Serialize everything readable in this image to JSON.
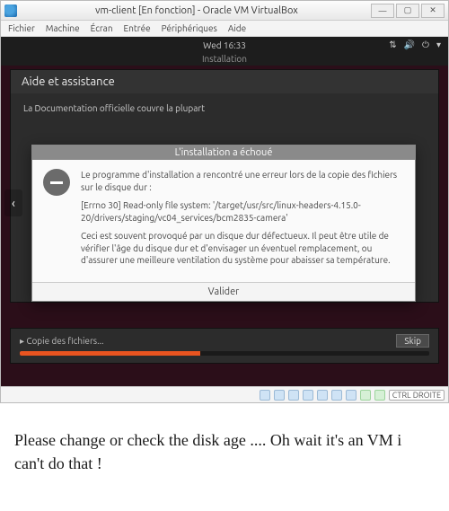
{
  "vb": {
    "title": "vm-client [En fonction] - Oracle VM VirtualBox",
    "menu": [
      "Fichier",
      "Machine",
      "Écran",
      "Entrée",
      "Périphériques",
      "Aide"
    ],
    "win_btns": {
      "min": "—",
      "max": "▢",
      "close": "✕"
    },
    "hostkey": "CTRL DROITE"
  },
  "gnome": {
    "clock": "Wed 16:33",
    "installing": "Installation",
    "net_icon": "⇅",
    "vol_icon": "🔊",
    "bat_icon": "⏻",
    "menu_icon": "▾"
  },
  "installer": {
    "title": "Aide et assistance",
    "intro": "La Documentation officielle couvre la plupart",
    "back": "‹"
  },
  "error": {
    "title": "L'installation a échoué",
    "p1": "Le programme d'installation a rencontré une erreur lors de la copie des fichiers sur le disque dur :",
    "p2": "[Errno 30] Read-only file system: '/target/usr/src/linux-headers-4.15.0-20/drivers/staging/vc04_services/bcm2835-camera'",
    "p3": "Ceci est souvent provoqué par un disque dur défectueux. Il peut être utile de vérifier l'âge du disque dur et d'envisager un éventuel remplacement, ou d'assurer une meilleure ventilation du système pour abaisser sa température.",
    "validate": "Valider"
  },
  "copybar": {
    "arrow": "▸",
    "label": "Copie des fichiers...",
    "skip": "Skip"
  },
  "caption": "Please change or check the disk age .... Oh wait it's an VM i can't do that !"
}
